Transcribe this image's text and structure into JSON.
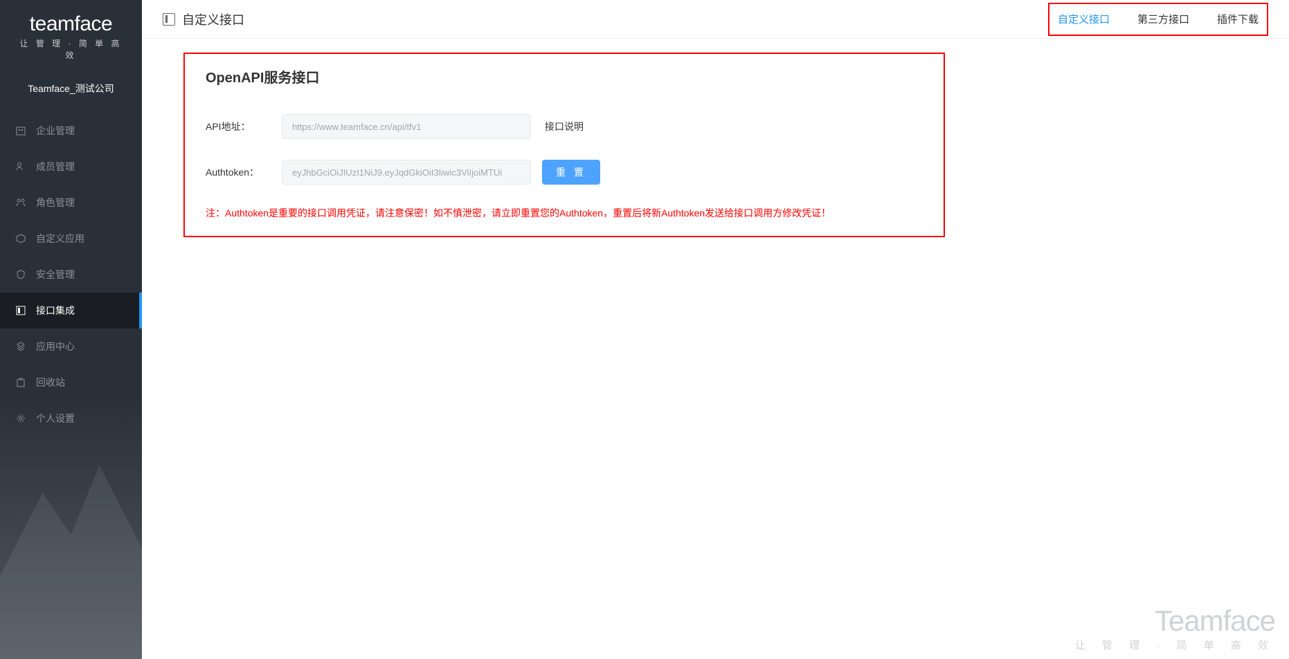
{
  "brand": {
    "logo": "teamface",
    "tagline": "让 管 理 · 简 单 高 效",
    "watermark_title": "Teamface",
    "watermark_sub": "让 管 理 · 简 单 高 效"
  },
  "company": "Teamface_测试公司",
  "sidebar": {
    "items": [
      {
        "label": "企业管理",
        "icon": "enterprise-icon",
        "active": false
      },
      {
        "label": "成员管理",
        "icon": "members-icon",
        "active": false
      },
      {
        "label": "角色管理",
        "icon": "roles-icon",
        "active": false
      },
      {
        "label": "自定义应用",
        "icon": "custom-app-icon",
        "active": false
      },
      {
        "label": "安全管理",
        "icon": "security-icon",
        "active": false
      },
      {
        "label": "接口集成",
        "icon": "api-icon",
        "active": true
      },
      {
        "label": "应用中心",
        "icon": "app-center-icon",
        "active": false
      },
      {
        "label": "回收站",
        "icon": "recycle-icon",
        "active": false
      },
      {
        "label": "个人设置",
        "icon": "personal-icon",
        "active": false
      }
    ]
  },
  "header": {
    "page_title": "自定义接口",
    "tabs": [
      {
        "label": "自定义接口",
        "active": true
      },
      {
        "label": "第三方接口",
        "active": false
      },
      {
        "label": "插件下载",
        "active": false
      }
    ]
  },
  "card": {
    "title": "OpenAPI服务接口",
    "api_label": "API地址：",
    "api_placeholder": "https://www.teamface.cn/api/tfv1",
    "api_doc_link": "接口说明",
    "token_label": "Authtoken：",
    "token_placeholder": "eyJhbGciOiJIUzI1NiJ9.eyJqdGkiOiI3Iiwic3ViIjoiMTUi",
    "reset_button": "重 置",
    "warning": "注：Authtoken是重要的接口调用凭证，请注意保密！如不慎泄密，请立即重置您的Authtoken，重置后将新Authtoken发送给接口调用方修改凭证！"
  }
}
